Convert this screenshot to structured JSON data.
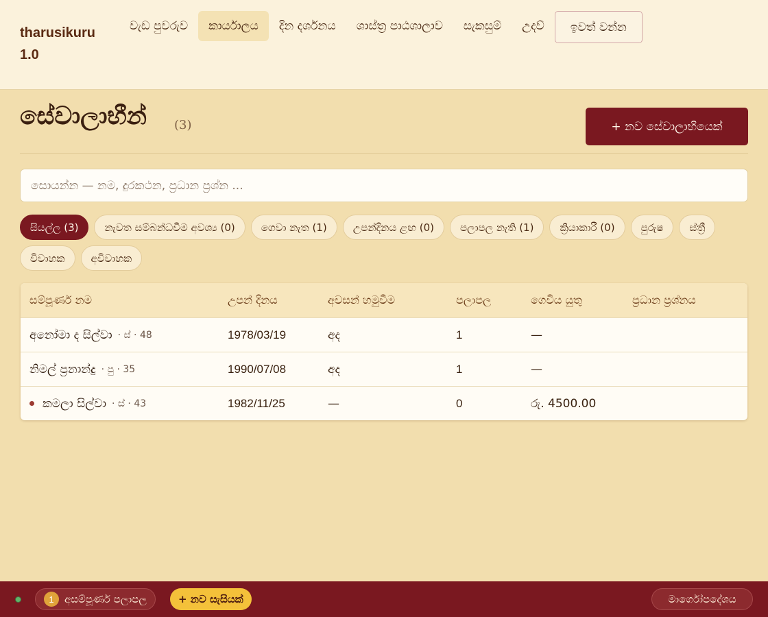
{
  "app": {
    "brand": "tharusikuru 1.0"
  },
  "nav": {
    "items": [
      {
        "label": "වැඩ පුවරුව"
      },
      {
        "label": "කාර්යාලය"
      },
      {
        "label": "දින දර්ශනය"
      },
      {
        "label": "ශාස්ත්‍ර පාඨශාලාව"
      },
      {
        "label": "සැකසුම්"
      },
      {
        "label": "උදව්"
      }
    ],
    "active_index": 1,
    "logout_label": "ඉවත් වන්න"
  },
  "page": {
    "title": "සේවාලාභීන්",
    "count": "(3)",
    "new_button": "+ නව සේවාලාභියෙක්"
  },
  "search": {
    "placeholder": "සොයන්න — නම, දුරකථන, ප්‍රධාන ප්‍රශ්න ..."
  },
  "filters": [
    {
      "label": "සියල්ල (3)",
      "active": true
    },
    {
      "label": "නැවත සම්බන්ධවීම අවශ්‍ය (0)"
    },
    {
      "label": "ගෙවා නැත (1)"
    },
    {
      "label": "උපන්දිනය ළඟ (0)"
    },
    {
      "label": "පලාපල නැති (1)"
    },
    {
      "label": "ක්‍රියාකාරී (0)"
    },
    {
      "label": "පුරුෂ"
    },
    {
      "label": "ස්ත්‍රී"
    },
    {
      "label": "විවාහක"
    },
    {
      "label": "අවිවාහක"
    }
  ],
  "table": {
    "headers": [
      "සම්පූර්ණ නම",
      "උපන් දිනය",
      "අවසන් හමුවීම",
      "පලාපල",
      "ගෙවිය යුතු",
      "ප්‍රධාන ප්‍රශ්නය"
    ],
    "rows": [
      {
        "name": "අනෝමා ද සිල්වා",
        "meta": "· ස් · 48",
        "dob": "1978/03/19",
        "last": "අද",
        "readings": "1",
        "due": "—",
        "issue": "",
        "flag": false
      },
      {
        "name": "නිමල් ප්‍රනාන්දු",
        "meta": "· පු · 35",
        "dob": "1990/07/08",
        "last": "අද",
        "readings": "1",
        "due": "—",
        "issue": "",
        "flag": false
      },
      {
        "name": "කමලා සිල්වා",
        "meta": "· ස් · 43",
        "dob": "1982/11/25",
        "last": "—",
        "readings": "0",
        "due": "රු. 4500.00",
        "issue": "",
        "flag": true
      }
    ]
  },
  "footer": {
    "status": "online",
    "pending_count": "1",
    "pending_label": "අසම්පූර්ණ පලාපල",
    "new_session": "+ නව සැසියක්",
    "guide": "මාර්ගෝපදේශය"
  },
  "colors": {
    "accent": "#7a1820",
    "background": "#f2deae",
    "header": "#fbf2dc",
    "new_session": "#f4c13a",
    "badge": "#e0a33a",
    "status_online": "#62b36a"
  }
}
